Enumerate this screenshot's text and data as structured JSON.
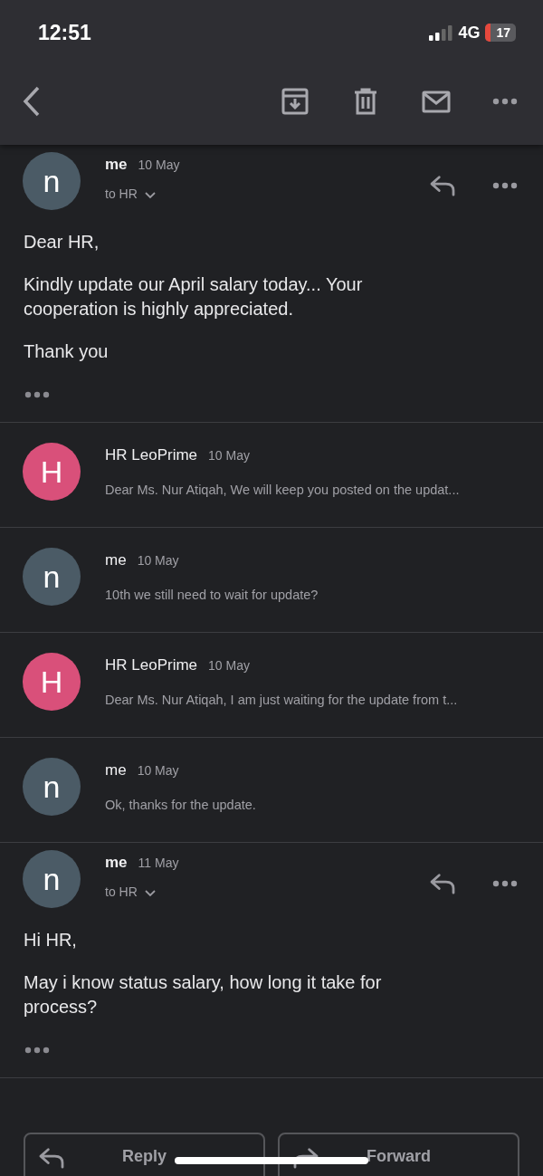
{
  "status_bar": {
    "time": "12:51",
    "network": "4G",
    "battery": "17"
  },
  "messages": [
    {
      "kind": "expanded",
      "avatar_letter": "n",
      "color": "#4b5b66",
      "sender": "me",
      "date": "10 May",
      "recipient": "to HR",
      "body": [
        "Dear HR,",
        "Kindly update our April salary today... Your cooperation is highly appreciated.",
        "Thank you"
      ]
    },
    {
      "kind": "collapsed",
      "avatar_letter": "H",
      "color": "#d9507a",
      "sender": "HR LeoPrime",
      "date": "10 May",
      "snippet": "Dear Ms. Nur Atiqah, We will keep you posted on the updat..."
    },
    {
      "kind": "collapsed",
      "avatar_letter": "n",
      "color": "#4b5b66",
      "sender": "me",
      "date": "10 May",
      "snippet": "10th we still need to wait for update?"
    },
    {
      "kind": "collapsed",
      "avatar_letter": "H",
      "color": "#d9507a",
      "sender": "HR LeoPrime",
      "date": "10 May",
      "snippet": "Dear Ms. Nur Atiqah, I am just waiting for the update from t..."
    },
    {
      "kind": "collapsed",
      "avatar_letter": "n",
      "color": "#4b5b66",
      "sender": "me",
      "date": "10 May",
      "snippet": "Ok, thanks for the update."
    },
    {
      "kind": "expanded",
      "avatar_letter": "n",
      "color": "#4b5b66",
      "sender": "me",
      "date": "11 May",
      "recipient": "to HR",
      "body": [
        "Hi HR,",
        "May i know status salary, how long it take for process?"
      ]
    }
  ],
  "actions": [
    {
      "kind": "reply",
      "label": "Reply"
    },
    {
      "kind": "forward",
      "label": "Forward"
    }
  ]
}
